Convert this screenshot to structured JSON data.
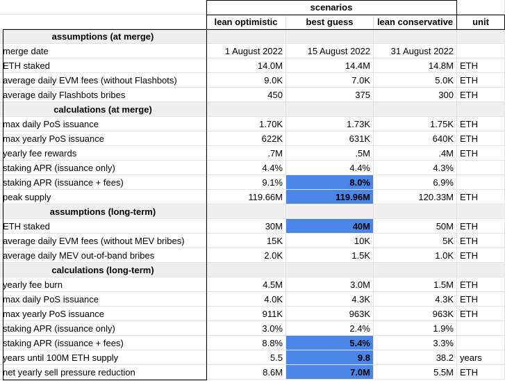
{
  "header": {
    "group_label": "scenarios",
    "columns": [
      "lean optimistic",
      "best guess",
      "lean conservative",
      "unit"
    ]
  },
  "highlight_color": "#4a86e8",
  "rows": [
    {
      "type": "section",
      "label": "assumptions (at merge)"
    },
    {
      "label": "merge date",
      "values": [
        "1 August 2022",
        "15 August 2022",
        "31 August 2022"
      ],
      "unit": ""
    },
    {
      "label": "ETH staked",
      "values": [
        "14.0M",
        "14.4M",
        "14.8M"
      ],
      "unit": "ETH"
    },
    {
      "label": "average daily EVM fees (without Flashbots)",
      "values": [
        "9.0K",
        "7.0K",
        "5.0K"
      ],
      "unit": "ETH"
    },
    {
      "label": "average daily Flashbots bribes",
      "values": [
        "450",
        "375",
        "300"
      ],
      "unit": "ETH"
    },
    {
      "type": "section",
      "label": "calculations (at merge)"
    },
    {
      "label": "max daily PoS issuance",
      "values": [
        "1.70K",
        "1.73K",
        "1.75K"
      ],
      "unit": "ETH"
    },
    {
      "label": "max yearly PoS issuance",
      "values": [
        "622K",
        "631K",
        "640K"
      ],
      "unit": "ETH"
    },
    {
      "label": "yearly fee rewards",
      "values": [
        ".7M",
        ".5M",
        ".4M"
      ],
      "unit": "ETH"
    },
    {
      "label": "staking APR (issuance only)",
      "values": [
        "4.4%",
        "4.4%",
        "4.3%"
      ],
      "unit": ""
    },
    {
      "label": "staking APR (issuance + fees)",
      "values": [
        "9.1%",
        "8.0%",
        "6.9%"
      ],
      "unit": "",
      "highlight": true
    },
    {
      "label": "peak supply",
      "values": [
        "119.66M",
        "119.96M",
        "120.33M"
      ],
      "unit": "ETH",
      "highlight": true
    },
    {
      "type": "section",
      "label": "assumptions (long-term)"
    },
    {
      "label": "ETH staked",
      "values": [
        "30M",
        "40M",
        "50M"
      ],
      "unit": "ETH",
      "highlight": true
    },
    {
      "label": "average daily EVM fees (without MEV bribes)",
      "values": [
        "15K",
        "10K",
        "5K"
      ],
      "unit": "ETH"
    },
    {
      "label": "average daily MEV out-of-band bribes",
      "values": [
        "2.0K",
        "1.5K",
        "1.0K"
      ],
      "unit": "ETH"
    },
    {
      "type": "section",
      "label": "calculations (long-term)"
    },
    {
      "label": "yearly fee burn",
      "values": [
        "4.5M",
        "3.0M",
        "1.5M"
      ],
      "unit": "ETH"
    },
    {
      "label": "max daily PoS issuance",
      "values": [
        "4.0K",
        "4.3K",
        "4.3K"
      ],
      "unit": "ETH"
    },
    {
      "label": "max yearly PoS issuance",
      "values": [
        "911K",
        "963K",
        "963K"
      ],
      "unit": "ETH"
    },
    {
      "label": "staking APR (issuance only)",
      "values": [
        "3.0%",
        "2.4%",
        "1.9%"
      ],
      "unit": ""
    },
    {
      "label": "staking APR (issuance + fees)",
      "values": [
        "8.8%",
        "5.4%",
        "3.3%"
      ],
      "unit": "",
      "highlight": true
    },
    {
      "label": "years until 100M ETH supply",
      "values": [
        "5.5",
        "9.8",
        "38.2"
      ],
      "unit": "years",
      "highlight": true
    },
    {
      "label": "net yearly sell pressure reduction",
      "values": [
        "8.6M",
        "7.0M",
        "5.5M"
      ],
      "unit": "ETH",
      "highlight": true
    }
  ]
}
